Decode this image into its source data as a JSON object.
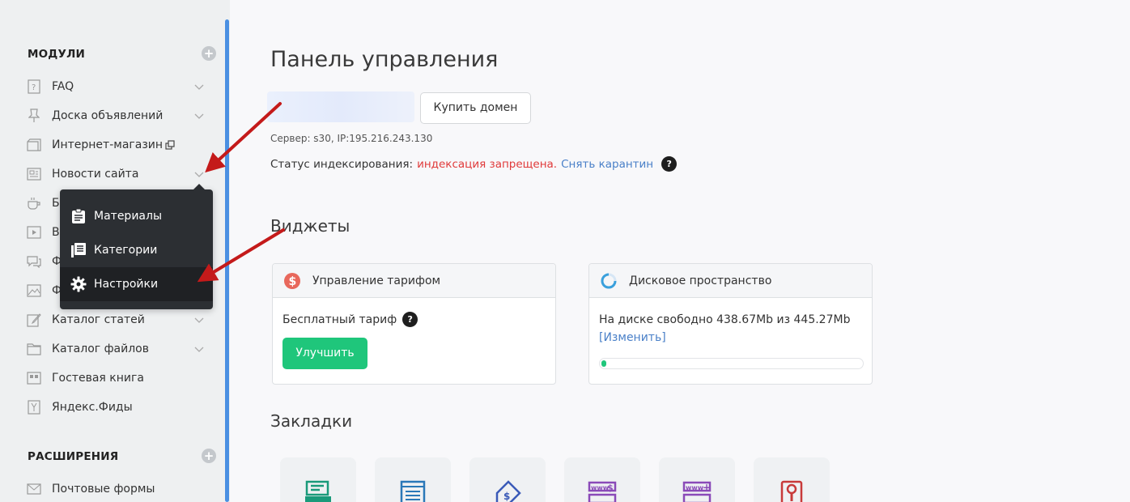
{
  "sidebar": {
    "modules_title": "МОДУЛИ",
    "extensions_title": "РАСШИРЕНИЯ",
    "items": [
      {
        "label": "FAQ",
        "icon": "question-box-icon"
      },
      {
        "label": "Доска объявлений",
        "icon": "pin-icon"
      },
      {
        "label": "Интернет-магазин",
        "icon": "shop-box-icon"
      },
      {
        "label": "Новости сайта",
        "icon": "news-icon"
      },
      {
        "label": "Б",
        "icon": "cup-icon"
      },
      {
        "label": "В",
        "icon": "video-icon"
      },
      {
        "label": "Ф",
        "icon": "forum-icon"
      },
      {
        "label": "Ф",
        "icon": "photo-icon"
      },
      {
        "label": "Каталог статей",
        "icon": "edit-icon"
      },
      {
        "label": "Каталог файлов",
        "icon": "folder-icon"
      },
      {
        "label": "Гостевая книга",
        "icon": "guestbook-icon"
      },
      {
        "label": "Яндекс.Фиды",
        "icon": "feed-icon"
      }
    ],
    "extensions": [
      {
        "label": "Почтовые формы",
        "icon": "mail-icon"
      }
    ]
  },
  "dropdown": {
    "items": [
      {
        "label": "Материалы",
        "icon": "clipboard-icon"
      },
      {
        "label": "Категории",
        "icon": "categories-icon"
      },
      {
        "label": "Настройки",
        "icon": "gear-icon"
      }
    ]
  },
  "main": {
    "title": "Панель управления",
    "buy_domain": "Купить домен",
    "server": "Сервер: s30, IP:195.216.243.130",
    "index_label": "Статус индексирования:",
    "index_status": "индексация запрещена.",
    "index_action": "Снять карантин",
    "help": "?",
    "widgets_title": "Виджеты",
    "bookmarks_title": "Закладки",
    "tariff": {
      "title": "Управление тарифом",
      "plan": "Бесплатный тариф",
      "upgrade": "Улучшить"
    },
    "disk": {
      "title": "Дисковое пространство",
      "free": "На диске свободно 438.67Mb из 445.27Mb",
      "change": "[Изменить]",
      "used_fraction": 0.015
    }
  },
  "colors": {
    "accent": "#4a90e2",
    "green": "#1fc67b",
    "danger": "#e03a3a",
    "link": "#4a80c8",
    "arrow": "#c41a1a"
  }
}
